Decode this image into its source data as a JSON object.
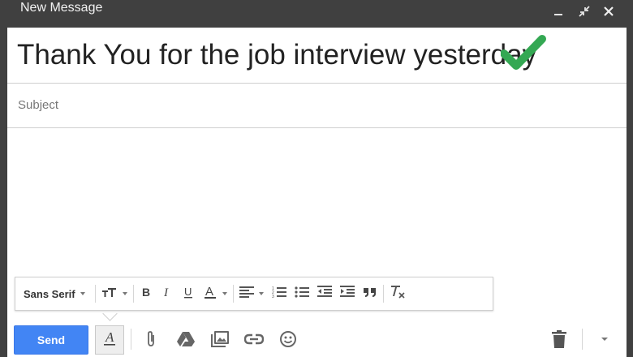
{
  "window": {
    "title": "New Message"
  },
  "compose": {
    "to_text": "Thank You for the job interview yesterday",
    "subject_placeholder": "Subject"
  },
  "format_bar": {
    "font_family": "Sans Serif",
    "tools": [
      "size-icon",
      "bold-icon",
      "italic-icon",
      "underline-icon",
      "text-color-icon",
      "align-icon",
      "numbered-list-icon",
      "bulleted-list-icon",
      "indent-less-icon",
      "indent-more-icon",
      "quote-icon",
      "remove-formatting-icon"
    ]
  },
  "footer": {
    "send_label": "Send",
    "icons": [
      "formatting-options-icon",
      "attach-icon",
      "drive-icon",
      "photo-icon",
      "link-icon",
      "emoji-icon",
      "trash-icon",
      "more-options-icon"
    ]
  },
  "colors": {
    "send_blue": "#4285f4",
    "titlebar": "#404040",
    "check_green": "#34a853"
  }
}
